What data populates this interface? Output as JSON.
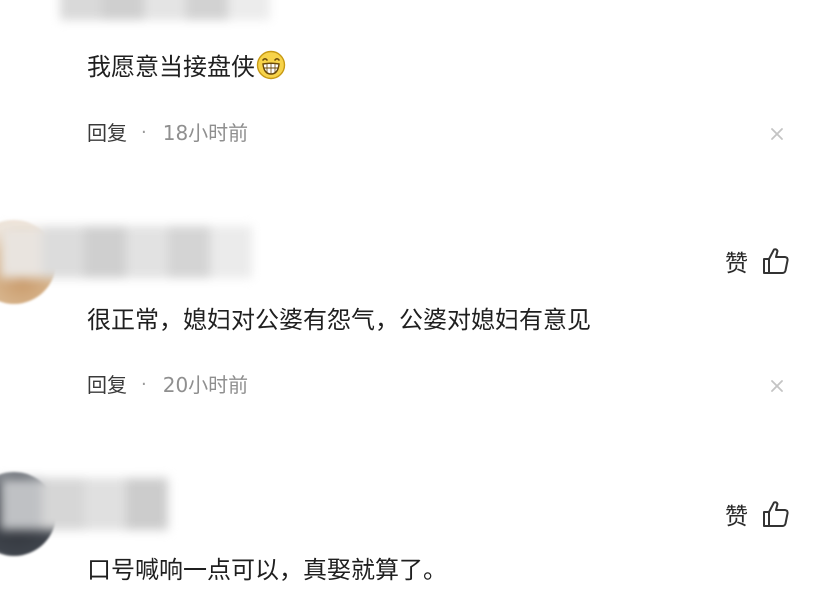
{
  "comments": [
    {
      "text": "我愿意当接盘侠",
      "emoji_icon": "grinning-face-icon",
      "reply_label": "回复",
      "separator": "·",
      "time": "18小时前"
    },
    {
      "text": "很正常，媳妇对公婆有怨气，公婆对媳妇有意见",
      "like_label": "赞",
      "like_icon": "thumbs-up-icon",
      "reply_label": "回复",
      "separator": "·",
      "time": "20小时前"
    },
    {
      "text": "口号喊响一点可以，真娶就算了。",
      "like_label": "赞",
      "like_icon": "thumbs-up-icon"
    }
  ],
  "colors": {
    "text": "#1f1f1f",
    "meta_time": "#8f8f8f",
    "close_icon": "#c4c4c4"
  }
}
